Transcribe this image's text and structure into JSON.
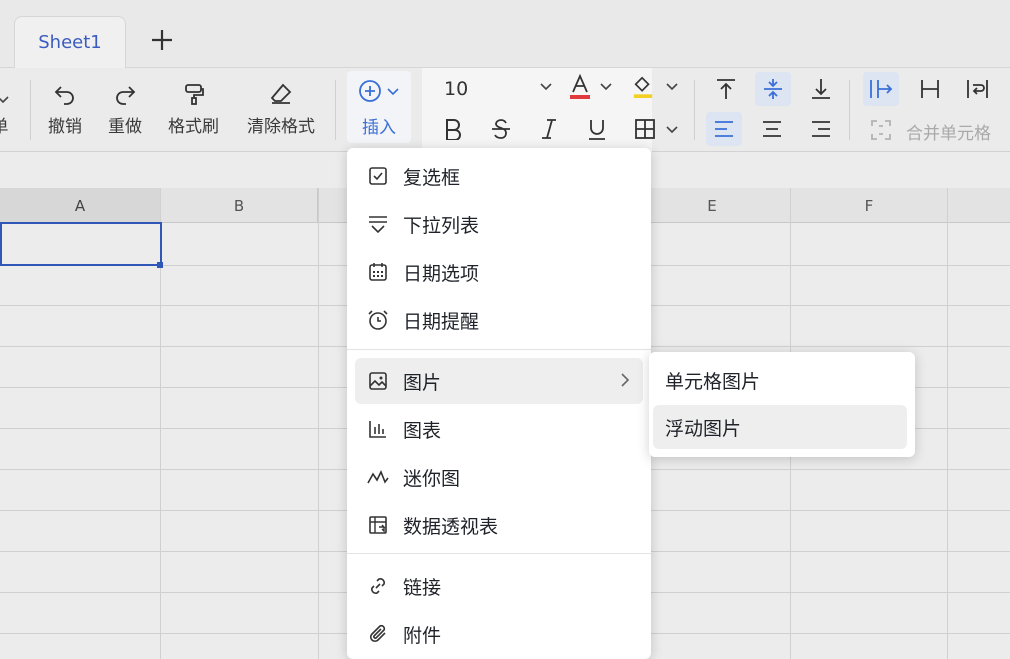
{
  "tabs": {
    "sheet1": "Sheet1"
  },
  "toolbar": {
    "partial_left": "单",
    "undo": "撤销",
    "redo": "重做",
    "format_painter": "格式刷",
    "clear_format": "清除格式",
    "insert": "插入",
    "font_size": "10",
    "merge_cells": "合并单元格"
  },
  "columns": [
    "A",
    "B",
    "",
    "",
    "E",
    "F"
  ],
  "menu": {
    "items": [
      {
        "label": "复选框",
        "icon": "checkbox-icon"
      },
      {
        "label": "下拉列表",
        "icon": "dropdown-list-icon"
      },
      {
        "label": "日期选项",
        "icon": "calendar-icon"
      },
      {
        "label": "日期提醒",
        "icon": "alarm-clock-icon"
      },
      {
        "label": "图片",
        "icon": "image-icon"
      },
      {
        "label": "图表",
        "icon": "chart-icon"
      },
      {
        "label": "迷你图",
        "icon": "sparkline-icon"
      },
      {
        "label": "数据透视表",
        "icon": "pivot-table-icon"
      },
      {
        "label": "链接",
        "icon": "link-icon"
      },
      {
        "label": "附件",
        "icon": "paperclip-icon"
      }
    ]
  },
  "submenu": {
    "items": [
      {
        "label": "单元格图片"
      },
      {
        "label": "浮动图片"
      }
    ]
  },
  "colors": {
    "accent": "#3a6fd8",
    "selection": "#3056b8",
    "font_color_bar": "#e0393e",
    "fill_color_bar": "#f2d024"
  }
}
